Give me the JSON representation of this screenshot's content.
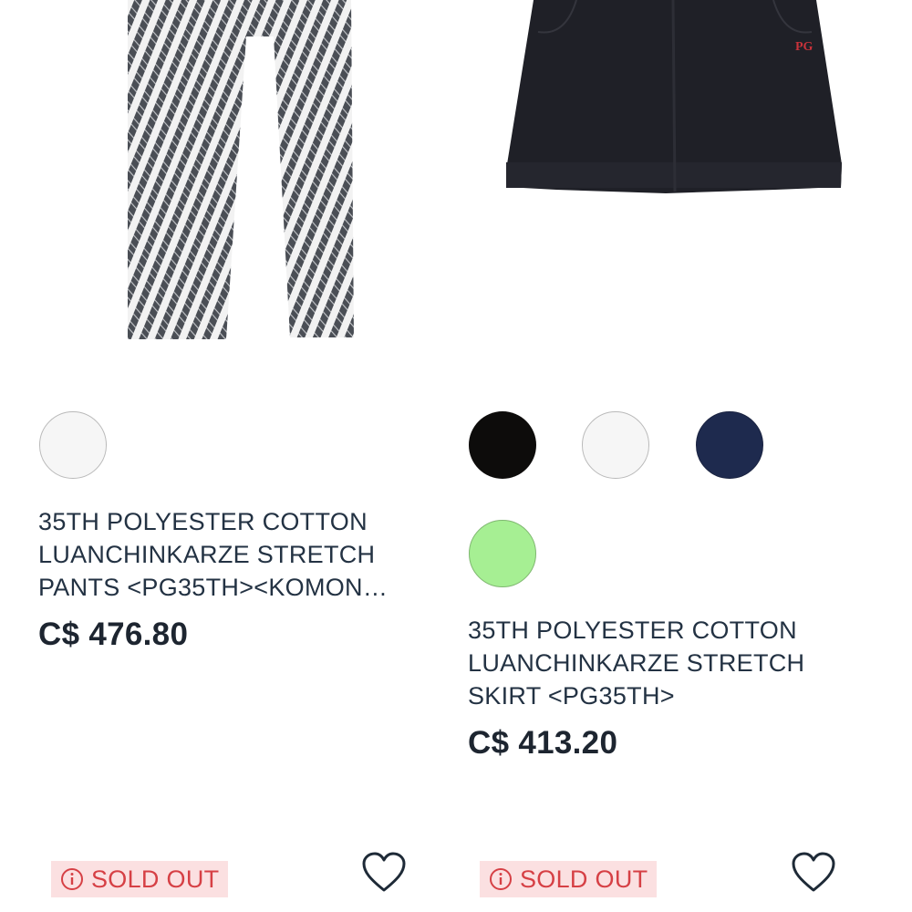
{
  "products": [
    {
      "image_alt": "Pants",
      "swatches": [
        {
          "name": "white",
          "color": "#f6f6f6"
        }
      ],
      "title_lines": [
        "35TH POLYESTER COTTON",
        "LUANCHINKARZE STRETCH",
        "PANTS <PG35TH><KOMON…"
      ],
      "price": "C$ 476.80",
      "badge": "SOLD OUT",
      "wishlist_icon": "heart-outline-icon"
    },
    {
      "image_alt": "Skirt",
      "swatches": [
        {
          "name": "black",
          "color": "#0d0c0b"
        },
        {
          "name": "white",
          "color": "#f6f6f6"
        },
        {
          "name": "navy",
          "color": "#1e2a4e"
        },
        {
          "name": "green",
          "color": "#a6ef93"
        }
      ],
      "title_lines": [
        "35TH POLYESTER COTTON",
        "LUANCHINKARZE STRETCH",
        "SKIRT <PG35TH>"
      ],
      "price": "C$ 413.20",
      "badge": "SOLD OUT",
      "wishlist_icon": "heart-outline-icon"
    }
  ],
  "colors": {
    "text": "#233243",
    "price": "#1d2530",
    "badge_bg": "#fbe0e1",
    "badge_text": "#d64045"
  }
}
